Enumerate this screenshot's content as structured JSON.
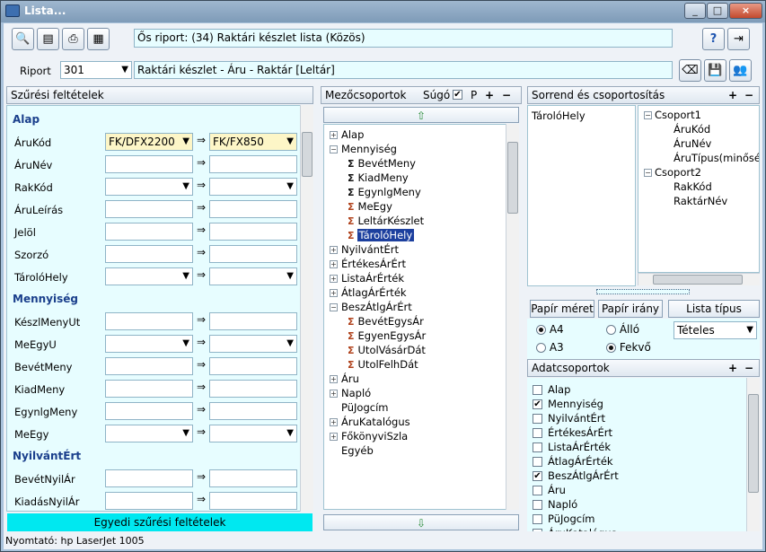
{
  "window": {
    "title": "Lista..."
  },
  "caption_buttons": {
    "min": "_",
    "max": "□",
    "close": "×"
  },
  "header": {
    "report_title": "Ős riport: (34)  Raktári készlet lista (Közös)",
    "riport_label": "Riport",
    "riport_value": "301",
    "riport_name": "Raktári készlet - Áru - Raktár [Leltár]"
  },
  "filters": {
    "panel_title": "Szűrési feltételek",
    "sections": [
      {
        "title": "Alap",
        "rows": [
          {
            "label": "ÁruKód",
            "from": "FK/DFX2200",
            "to": "FK/FX850",
            "type": "combo",
            "yellow": true
          },
          {
            "label": "ÁruNév",
            "from": "",
            "to": "",
            "type": "text"
          },
          {
            "label": "RakKód",
            "from": "",
            "to": "",
            "type": "combo"
          },
          {
            "label": "ÁruLeírás",
            "from": "",
            "to": "",
            "type": "text"
          },
          {
            "label": "Jelöl",
            "from": "",
            "to": "",
            "type": "text"
          },
          {
            "label": "Szorzó",
            "from": "",
            "to": "",
            "type": "text"
          },
          {
            "label": "TárolóHely",
            "from": "",
            "to": "",
            "type": "combo"
          }
        ]
      },
      {
        "title": "Mennyiség",
        "rows": [
          {
            "label": "KészlMenyUt",
            "from": "",
            "to": "",
            "type": "text"
          },
          {
            "label": "MeEgyU",
            "from": "",
            "to": "",
            "type": "combo"
          },
          {
            "label": "BevétMeny",
            "from": "",
            "to": "",
            "type": "text"
          },
          {
            "label": "KiadMeny",
            "from": "",
            "to": "",
            "type": "text"
          },
          {
            "label": "EgynlgMeny",
            "from": "",
            "to": "",
            "type": "text"
          },
          {
            "label": "MeEgy",
            "from": "",
            "to": "",
            "type": "combo"
          }
        ]
      },
      {
        "title": "NyilvántÉrt",
        "rows": [
          {
            "label": "BevétNyilÁr",
            "from": "",
            "to": "",
            "type": "text"
          },
          {
            "label": "KiadásNyilÁr",
            "from": "",
            "to": "",
            "type": "text"
          }
        ]
      }
    ],
    "arrow": "⇒",
    "bottom_button": "Egyedi szűrési feltételek"
  },
  "fieldgroups": {
    "panel_title": "Mezőcsoportok",
    "help_label": "Súgó",
    "p_label": "P",
    "items": [
      {
        "label": "Alap",
        "level": 0,
        "exp": "+"
      },
      {
        "label": "Mennyiség",
        "level": 0,
        "exp": "−"
      },
      {
        "label": "BevétMeny",
        "level": 1,
        "icon": "Σ"
      },
      {
        "label": "KiadMeny",
        "level": 1,
        "icon": "Σ"
      },
      {
        "label": "EgynlgMeny",
        "level": 1,
        "icon": "Σ"
      },
      {
        "label": "MeEgy",
        "level": 1,
        "icon": "Σo"
      },
      {
        "label": "LeltárKészlet",
        "level": 1,
        "icon": "Σo"
      },
      {
        "label": "TárolóHely",
        "level": 1,
        "icon": "Σo",
        "selected": true
      },
      {
        "label": "NyilvántÉrt",
        "level": 0,
        "exp": "+"
      },
      {
        "label": "ÉrtékesÁrÉrt",
        "level": 0,
        "exp": "+"
      },
      {
        "label": "ListaÁrÉrték",
        "level": 0,
        "exp": "+"
      },
      {
        "label": "ÁtlagÁrÉrték",
        "level": 0,
        "exp": "+"
      },
      {
        "label": "BeszÁtlgÁrÉrt",
        "level": 0,
        "exp": "−"
      },
      {
        "label": "BevétEgysÁr",
        "level": 1,
        "icon": "Σo"
      },
      {
        "label": "EgyenEgysÁr",
        "level": 1,
        "icon": "Σo"
      },
      {
        "label": "UtolVásárDát",
        "level": 1,
        "icon": "Σo"
      },
      {
        "label": "UtolFelhDát",
        "level": 1,
        "icon": "Σo"
      },
      {
        "label": "Áru",
        "level": 0,
        "exp": "+"
      },
      {
        "label": "Napló",
        "level": 0,
        "exp": "+"
      },
      {
        "label": "PüJogcím",
        "level": 0,
        "exp": ""
      },
      {
        "label": "ÁruKatalógus",
        "level": 0,
        "exp": "+"
      },
      {
        "label": "FőkönyviSzla",
        "level": 0,
        "exp": "+"
      },
      {
        "label": "Egyéb",
        "level": 0,
        "exp": ""
      }
    ]
  },
  "sorting": {
    "panel_title": "Sorrend és csoportosítás",
    "order_list": [
      "TárolóHely"
    ],
    "groups": [
      {
        "label": "Csoport1",
        "level": 0
      },
      {
        "label": "ÁruKód",
        "level": 1
      },
      {
        "label": "ÁruNév",
        "level": 1
      },
      {
        "label": "ÁruTípus(minőség)",
        "level": 1
      },
      {
        "label": "Csoport2",
        "level": 0
      },
      {
        "label": "RakKód",
        "level": 1
      },
      {
        "label": "RaktárNév",
        "level": 1
      }
    ]
  },
  "paper": {
    "size_label": "Papír méret",
    "orient_label": "Papír irány",
    "list_type_label": "Lista típus",
    "a4": "A4",
    "a3": "A3",
    "portrait": "Álló",
    "landscape": "Fekvő",
    "list_type_value": "Tételes"
  },
  "datagroups": {
    "panel_title": "Adatcsoportok",
    "items": [
      {
        "label": "Alap",
        "checked": false
      },
      {
        "label": "Mennyiség",
        "checked": true
      },
      {
        "label": "NyilvántÉrt",
        "checked": false
      },
      {
        "label": "ÉrtékesÁrÉrt",
        "checked": false
      },
      {
        "label": "ListaÁrÉrték",
        "checked": false
      },
      {
        "label": "ÁtlagÁrÉrték",
        "checked": false
      },
      {
        "label": "BeszÁtlgÁrÉrt",
        "checked": true
      },
      {
        "label": "Áru",
        "checked": false
      },
      {
        "label": "Napló",
        "checked": false
      },
      {
        "label": "PüJogcím",
        "checked": false
      },
      {
        "label": "ÁruKatalógus",
        "checked": false
      }
    ]
  },
  "status": {
    "printer": "Nyomtató: hp LaserJet 1005"
  },
  "colors": {
    "panel_bg": "#e7fdff",
    "accent": "#00e8f0",
    "title_bar": "#8aa7c4"
  }
}
